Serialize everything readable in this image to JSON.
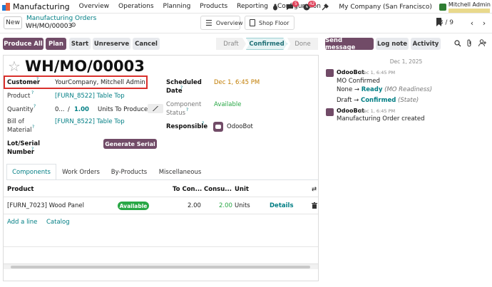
{
  "navbar": {
    "app_title": "Manufacturing",
    "menu": [
      "Overview",
      "Operations",
      "Planning",
      "Products",
      "Reporting",
      "Configuration"
    ],
    "badges": {
      "messages": "5",
      "activities": "42"
    },
    "company": "My Company (San Francisco)",
    "user": "Mitchell Admin"
  },
  "control": {
    "new_label": "New",
    "breadcrumb_parent": "Manufacturing Orders",
    "breadcrumb_current": "WH/MO/00003",
    "overview_label": "Overview",
    "shopfloor_label": "Shop Floor",
    "pager": "3 / 9"
  },
  "actions": {
    "produce_all": "Produce All",
    "plan": "Plan",
    "start": "Start",
    "unreserve": "Unreserve",
    "cancel": "Cancel",
    "stages": [
      "Draft",
      "Confirmed",
      "Done"
    ],
    "active_stage": "Confirmed"
  },
  "form": {
    "title": "WH/MO/00003",
    "customer_label": "Customer",
    "customer_value": "YourCompany, Mitchell Admin",
    "product_label": "Product",
    "product_value": "[FURN_8522] Table Top",
    "quantity_label": "Quantity",
    "quantity_produced": "0...",
    "quantity_sep": "/",
    "quantity_value": "1.00",
    "quantity_units": "Units To Produce",
    "bom_label_1": "Bill of",
    "bom_label_2": "Material",
    "bom_value": "[FURN_8522] Table Top",
    "lot_label_1": "Lot/Serial",
    "lot_label_2": "Number",
    "generate_serial": "Generate Serial",
    "scheduled_label_1": "Scheduled",
    "scheduled_label_2": "Date",
    "scheduled_value": "Dec 1, 6:45 PM",
    "component_label_1": "Component",
    "component_label_2": "Status",
    "component_value": "Available",
    "responsible_label": "Responsible",
    "responsible_value": "OdooBot",
    "help_mark": "?"
  },
  "tabs": [
    "Components",
    "Work Orders",
    "By-Products",
    "Miscellaneous"
  ],
  "table": {
    "headers": [
      "Product",
      "To Con...",
      "Consu...",
      "Unit"
    ],
    "rows": [
      {
        "product": "[FURN_7023] Wood Panel",
        "status": "Available",
        "to_consume": "2.00",
        "consumed": "2.00",
        "unit": "Units",
        "details": "Details"
      }
    ],
    "add_line": "Add a line",
    "catalog": "Catalog"
  },
  "chatter": {
    "send_message": "Send message",
    "log_note": "Log note",
    "activity": "Activity",
    "date_separator": "Dec 1, 2025",
    "messages": [
      {
        "author": "OdooBot",
        "time": "Dec 1, 6:45 PM",
        "title": "MO Confirmed",
        "line1_from": "None",
        "line1_arrow": "→",
        "line1_to": "Ready",
        "line1_field": "(MO Readiness)",
        "line2_from": "Draft",
        "line2_arrow": "→",
        "line2_to": "Confirmed",
        "line2_field": "(State)"
      },
      {
        "author": "OdooBot",
        "time": "Dec 1, 6:45 PM",
        "title": "Manufacturing Order created"
      }
    ]
  },
  "colors": {
    "primary": "#714b67",
    "link": "#017e84",
    "success": "#28a745",
    "highlight": "#d9302c",
    "warning": "#c17c00"
  }
}
